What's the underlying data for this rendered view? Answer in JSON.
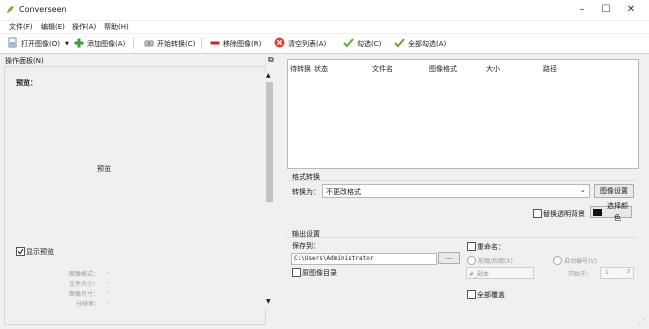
{
  "app": {
    "title": "Converseen"
  },
  "menu": [
    "文件(F)",
    "编辑(E)",
    "操作(A)",
    "帮助(H)"
  ],
  "toolbar": {
    "open": "打开图像(O)",
    "add": "添加图像(A)",
    "start": "开始转换(C)",
    "remove": "移除图像(R)",
    "clear": "清空列表(A)",
    "check": "勾选(C)",
    "check_all": "全部勾选(A)"
  },
  "left_panel": {
    "title": "操作面板(N)",
    "preview_header": "预览：",
    "preview_center": "预览",
    "show_preview": "显示预览",
    "info": [
      {
        "label": "图像格式：",
        "value": "-"
      },
      {
        "label": "文件大小：",
        "value": "-"
      },
      {
        "label": "图像尺寸：",
        "value": "-"
      },
      {
        "label": "分辨率：",
        "value": "-"
      }
    ]
  },
  "file_list": {
    "headers": [
      "待转换",
      "状态",
      "文件名",
      "图像格式",
      "大小",
      "路径"
    ]
  },
  "format": {
    "group_title": "格式转换",
    "convert_to_label": "转换为：",
    "convert_to_value": "不更改格式",
    "settings_button": "图像设置",
    "replace_bg": "替换透明背景",
    "choose_color": "选择颜色"
  },
  "output": {
    "group_title": "输出设置",
    "save_to_label": "保存到：",
    "save_path": "C:\\Users\\Administrator",
    "browse_button": "...",
    "original_dir": "原图像目录",
    "rename": "重命名：",
    "prefix_suffix": "前缀/后缀(X)",
    "auto_number": "自动编号(V)",
    "name_pattern": "#_副本",
    "start_from_label": "开始于：",
    "start_from_value": "1",
    "overwrite_all": "全部覆盖"
  },
  "colors": {
    "toolbar_bg": "#ffffff",
    "panel_bg": "#f0f0f0",
    "check_green": "#6aa832",
    "remove_red": "#d0262a",
    "clear_red": "#e23b2f",
    "add_green": "#3f9c3a"
  }
}
